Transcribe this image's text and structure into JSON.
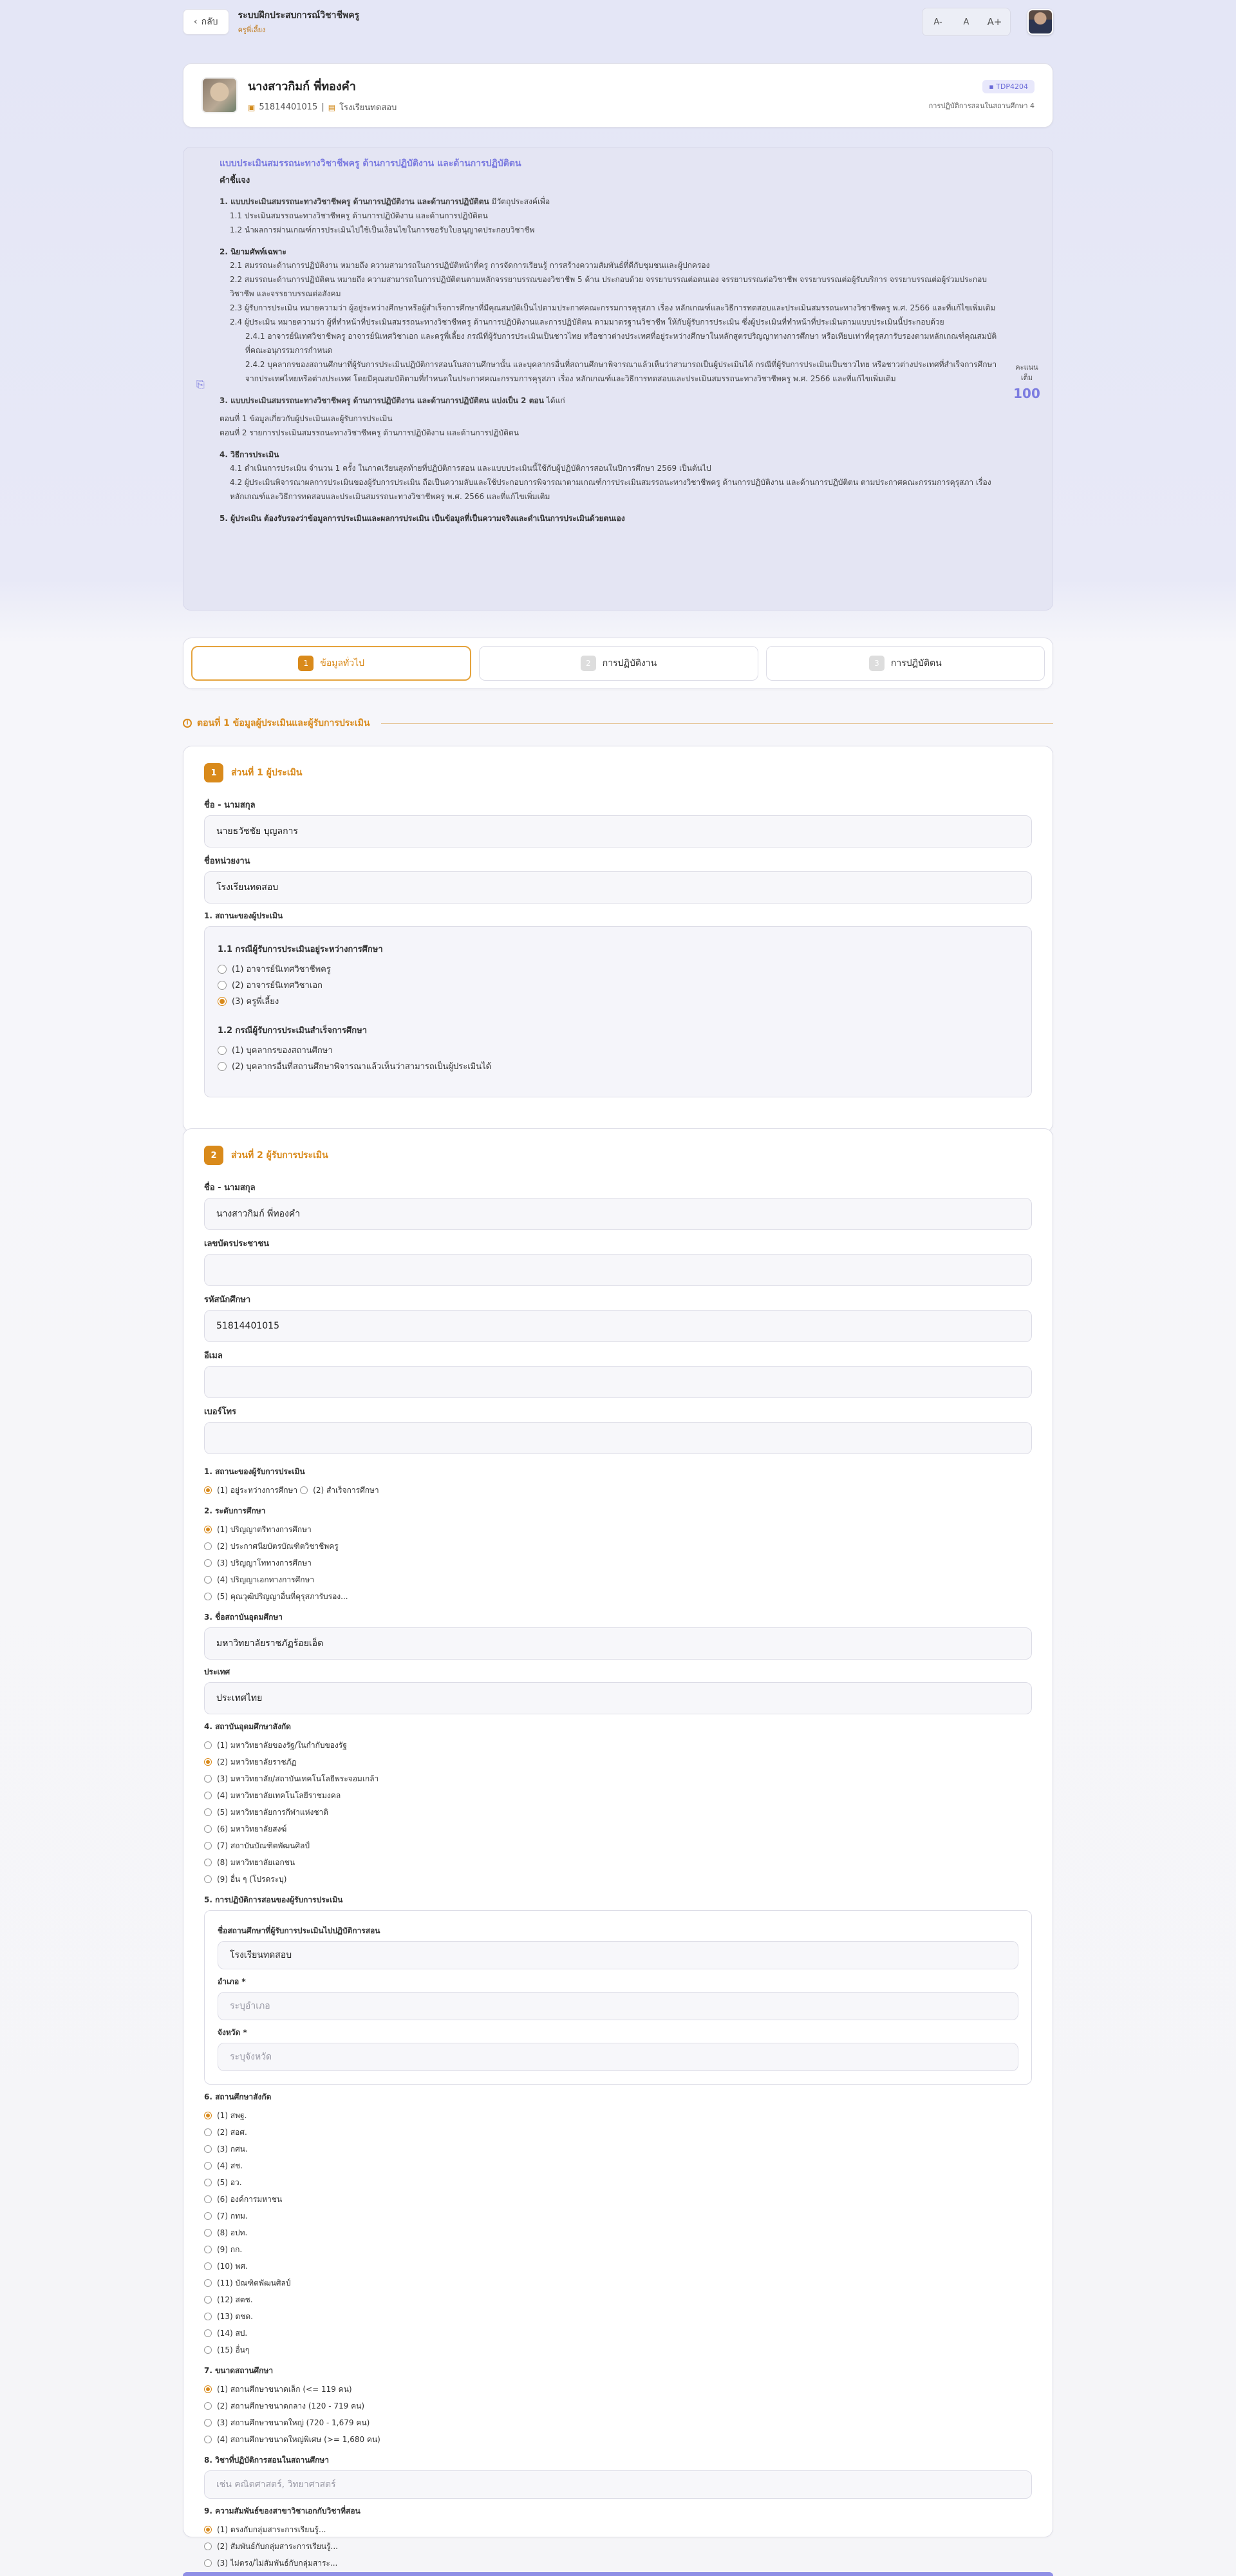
{
  "header": {
    "back_label": "กลับ",
    "app_title": "ระบบฝึกประสบการณ์วิชาชีพครู",
    "role": "ครูพี่เลี้ยง",
    "font_small": "A-",
    "font_normal": "A",
    "font_large": "A+"
  },
  "profile": {
    "name": "นางสาวกิมก์ พี่ทองคำ",
    "student_id": "51814401015",
    "separator": "|",
    "school": "โรงเรียนทดสอบ",
    "badge": "TDP4204",
    "course": "การปฏิบัติการสอนในสถานศึกษา 4"
  },
  "instructions": {
    "title": "แบบประเมินสมรรถนะทางวิชาชีพครู ด้านการปฏิบัติงาน และด้านการปฏิบัติตน",
    "heading": "คำชี้แจง",
    "s1_title": "1. แบบประเมินสมรรถนะทางวิชาชีพครู ด้านการปฏิบัติงาน และด้านการปฏิบัติตน",
    "s1_title_tail": "มีวัตถุประสงค์เพื่อ",
    "s1_p1": "1.1 ประเมินสมรรถนะทางวิชาชีพครู ด้านการปฏิบัติงาน และด้านการปฏิบัติตน",
    "s1_p2": "1.2 นำผลการผ่านเกณฑ์การประเมินไปใช้เป็นเงื่อนไขในการขอรับใบอนุญาตประกอบวิชาชีพ",
    "s2_title": "2. นิยามศัพท์เฉพาะ",
    "s2_p1": "2.1 สมรรถนะด้านการปฏิบัติงาน หมายถึง ความสามารถในการปฏิบัติหน้าที่ครู การจัดการเรียนรู้ การสร้างความสัมพันธ์ที่ดีกับชุมชนและผู้ปกครอง",
    "s2_p2": "2.2 สมรรถนะด้านการปฏิบัติตน หมายถึง ความสามารถในการปฏิบัติตนตามหลักจรรยาบรรณของวิชาชีพ 5 ด้าน ประกอบด้วย จรรยาบรรณต่อตนเอง จรรยาบรรณต่อวิชาชีพ จรรยาบรรณต่อผู้รับบริการ จรรยาบรรณต่อผู้ร่วมประกอบวิชาชีพ และจรรยาบรรณต่อสังคม",
    "s2_p3": "2.3 ผู้รับการประเมิน หมายความว่า ผู้อยู่ระหว่างศึกษาหรือผู้สำเร็จการศึกษาที่มีคุณสมบัติเป็นไปตามประกาศคณะกรรมการคุรุสภา เรื่อง หลักเกณฑ์และวิธีการทดสอบและประเมินสมรรถนะทางวิชาชีพครู พ.ศ. 2566 และที่แก้ไขเพิ่มเติม",
    "s2_p4": "2.4 ผู้ประเมิน หมายความว่า ผู้ที่ทำหน้าที่ประเมินสมรรถนะทางวิชาชีพครู ด้านการปฏิบัติงานและการปฏิบัติตน ตามมาตรฐานวิชาชีพ ให้กับผู้รับการประเมิน ซึ่งผู้ประเมินที่ทำหน้าที่ประเมินตามแบบประเมินนี้ประกอบด้วย",
    "s2_p5": "2.4.1 อาจารย์นิเทศวิชาชีพครู อาจารย์นิเทศวิชาเอก และครูพี่เลี้ยง กรณีที่ผู้รับการประเมินเป็นชาวไทย หรือชาวต่างประเทศที่อยู่ระหว่างศึกษาในหลักสูตรปริญญาทางการศึกษา หรือเทียบเท่าที่คุรุสภารับรองตามหลักเกณฑ์คุณสมบัติที่คณะอนุกรรมการกำหนด",
    "s2_p6": "2.4.2 บุคลากรของสถานศึกษาที่ผู้รับการประเมินปฏิบัติการสอนในสถานศึกษานั้น และบุคลากรอื่นที่สถานศึกษาพิจารณาแล้วเห็นว่าสามารถเป็นผู้ประเมินได้ กรณีที่ผู้รับการประเมินเป็นชาวไทย หรือชาวต่างประเทศที่สำเร็จการศึกษาจากประเทศไทยหรือต่างประเทศ โดยมีคุณสมบัติตามที่กำหนดในประกาศคณะกรรมการคุรุสภา เรื่อง หลักเกณฑ์และวิธีการทดสอบและประเมินสมรรถนะทางวิชาชีพครู พ.ศ. 2566 และที่แก้ไขเพิ่มเติม",
    "s3_title": "3. แบบประเมินสมรรถนะทางวิชาชีพครู ด้านการปฏิบัติงาน และด้านการปฏิบัติตน แบ่งเป็น 2 ตอน",
    "s3_title_tail": "ได้แก่",
    "s3_p1": "ตอนที่ 1 ข้อมูลเกี่ยวกับผู้ประเมินและผู้รับการประเมิน",
    "s3_p2": "ตอนที่ 2 รายการประเมินสมรรถนะทางวิชาชีพครู ด้านการปฏิบัติงาน และด้านการปฏิบัติตน",
    "s4_title": "4. วิธีการประเมิน",
    "s4_p1": "4.1 ดำเนินการประเมิน จำนวน 1 ครั้ง ในภาคเรียนสุดท้ายที่ปฏิบัติการสอน และแบบประเมินนี้ใช้กับผู้ปฏิบัติการสอนในปีการศึกษา 2569 เป็นต้นไป",
    "s4_p2": "4.2 ผู้ประเมินพิจารณาผลการประเมินของผู้รับการประเมิน ถือเป็นความลับและใช้ประกอบการพิจารณาตามเกณฑ์การประเมินสมรรถนะทางวิชาชีพครู ด้านการปฏิบัติงาน และด้านการปฏิบัติตน ตามประกาศคณะกรรมการคุรุสภา เรื่อง หลักเกณฑ์และวิธีการทดสอบและประเมินสมรรถนะทางวิชาชีพครู พ.ศ. 2566 และที่แก้ไขเพิ่มเติม",
    "s5_title": "5. ผู้ประเมิน ต้องรับรองว่าข้อมูลการประเมินและผลการประเมิน เป็นข้อมูลที่เป็นความจริงและดำเนินการประเมินด้วยตนเอง",
    "score_label": "คะแนนเต็ม",
    "score": "100"
  },
  "tabs": [
    {
      "num": "1",
      "label": "ข้อมูลทั่วไป"
    },
    {
      "num": "2",
      "label": "การปฏิบัติงาน"
    },
    {
      "num": "3",
      "label": "การปฏิบัติตน"
    }
  ],
  "part_heading": "ตอนที่ 1 ข้อมูลผู้ประเมินและผู้รับการประเมิน",
  "section1": {
    "num": "1",
    "title": "ส่วนที่ 1 ผู้ประเมิน",
    "name_label": "ชื่อ - นามสกุล",
    "name_value": "นายธวัชชัย บุญลการ",
    "org_label": "ชื่อหน่วยงาน",
    "org_value": "โรงเรียนทดสอบ",
    "status_label": "1. สถานะของผู้ประเมิน",
    "g1_title": "1.1 กรณีผู้รับการประเมินอยู่ระหว่างการศึกษา",
    "g1_opts": [
      "(1) อาจารย์นิเทศวิชาชีพครู",
      "(2) อาจารย์นิเทศวิชาเอก",
      "(3) ครูพี่เลี้ยง"
    ],
    "g2_title": "1.2 กรณีผู้รับการประเมินสำเร็จการศึกษา",
    "g2_opts": [
      "(1) บุคลากรของสถานศึกษา",
      "(2) บุคลากรอื่นที่สถานศึกษาพิจารณาแล้วเห็นว่าสามารถเป็นผู้ประเมินได้"
    ]
  },
  "section2": {
    "num": "2",
    "title": "ส่วนที่ 2 ผู้รับการประเมิน",
    "name_label": "ชื่อ - นามสกุล",
    "name_value": "นางสาวกิมก์ พี่ทองคำ",
    "idcard_label": "เลขบัตรประชาชน",
    "sid_label": "รหัสนักศึกษา",
    "sid_value": "51814401015",
    "email_label": "อีเมล",
    "phone_label": "เบอร์โทร",
    "q1_label": "1. สถานะของผู้รับการประเมิน",
    "q1_opts": [
      "(1) อยู่ระหว่างการศึกษา",
      "(2) สำเร็จการศึกษา"
    ],
    "q2_label": "2. ระดับการศึกษา",
    "q2_opts": [
      "(1) ปริญญาตรีทางการศึกษา",
      "(2) ประกาศนียบัตรบัณฑิตวิชาชีพครู",
      "(3) ปริญญาโททางการศึกษา",
      "(4) ปริญญาเอกทางการศึกษา",
      "(5) คุณวุฒิปริญญาอื่นที่คุรุสภารับรอง..."
    ],
    "q3_label": "3. ชื่อสถาบันอุดมศึกษา",
    "q3_value": "มหาวิทยาลัยราชภัฏร้อยเอ็ด",
    "country_label": "ประเทศ",
    "country_value": "ประเทศไทย",
    "q4_label": "4. สถาบันอุดมศึกษาสังกัด",
    "q4_opts": [
      "(1) มหาวิทยาลัยของรัฐ/ในกำกับของรัฐ",
      "(2) มหาวิทยาลัยราชภัฏ",
      "(3) มหาวิทยาลัย/สถาบันเทคโนโลยีพระจอมเกล้า",
      "(4) มหาวิทยาลัยเทคโนโลยีราชมงคล",
      "(5) มหาวิทยาลัยการกีฬาแห่งชาติ",
      "(6) มหาวิทยาลัยสงฆ์",
      "(7) สถาบันบัณฑิตพัฒนศิลป์",
      "(8) มหาวิทยาลัยเอกชน",
      "(9) อื่น ๆ (โปรดระบุ)"
    ],
    "q5_label": "5. การปฏิบัติการสอนของผู้รับการประเมิน",
    "q5_school_label": "ชื่อสถานศึกษาที่ผู้รับการประเมินไปปฏิบัติการสอน",
    "q5_school_value": "โรงเรียนทดสอบ",
    "q5_district_label": "อำเภอ *",
    "q5_district_ph": "ระบุอำเภอ",
    "q5_province_label": "จังหวัด *",
    "q5_province_ph": "ระบุจังหวัด",
    "q6_label": "6. สถานศึกษาสังกัด",
    "q6_opts": [
      "(1) สพฐ.",
      "(2) สอศ.",
      "(3) กศน.",
      "(4) สช.",
      "(5) อว.",
      "(6) องค์การมหาชน",
      "(7) กทม.",
      "(8) อปท.",
      "(9) กก.",
      "(10) พศ.",
      "(11) บัณฑิตพัฒนศิลป์",
      "(12) สตช.",
      "(13) ตชด.",
      "(14) สป.",
      "(15) อื่นๆ"
    ],
    "q7_label": "7. ขนาดสถานศึกษา",
    "q7_opts": [
      "(1) สถานศึกษาขนาดเล็ก (<= 119 คน)",
      "(2) สถานศึกษาขนาดกลาง (120 - 719 คน)",
      "(3) สถานศึกษาขนาดใหญ่ (720 - 1,679 คน)",
      "(4) สถานศึกษาขนาดใหญ่พิเศษ (>= 1,680 คน)"
    ],
    "q8_label": "8. วิชาที่ปฏิบัติการสอนในสถานศึกษา",
    "q8_ph": "เช่น คณิตศาสตร์, วิทยาศาสตร์",
    "q9_label": "9. ความสัมพันธ์ของสาขาวิชาเอกกับวิชาที่สอน",
    "q9_opts": [
      "(1) ตรงกับกลุ่มสาระการเรียนรู้...",
      "(2) สัมพันธ์กับกลุ่มสาระการเรียนรู้...",
      "(3) ไม่ตรง/ไม่สัมพันธ์กับกลุ่มสาระ..."
    ]
  },
  "colors": {
    "accent": "#d98a1b",
    "brand": "#7c7ce0"
  }
}
